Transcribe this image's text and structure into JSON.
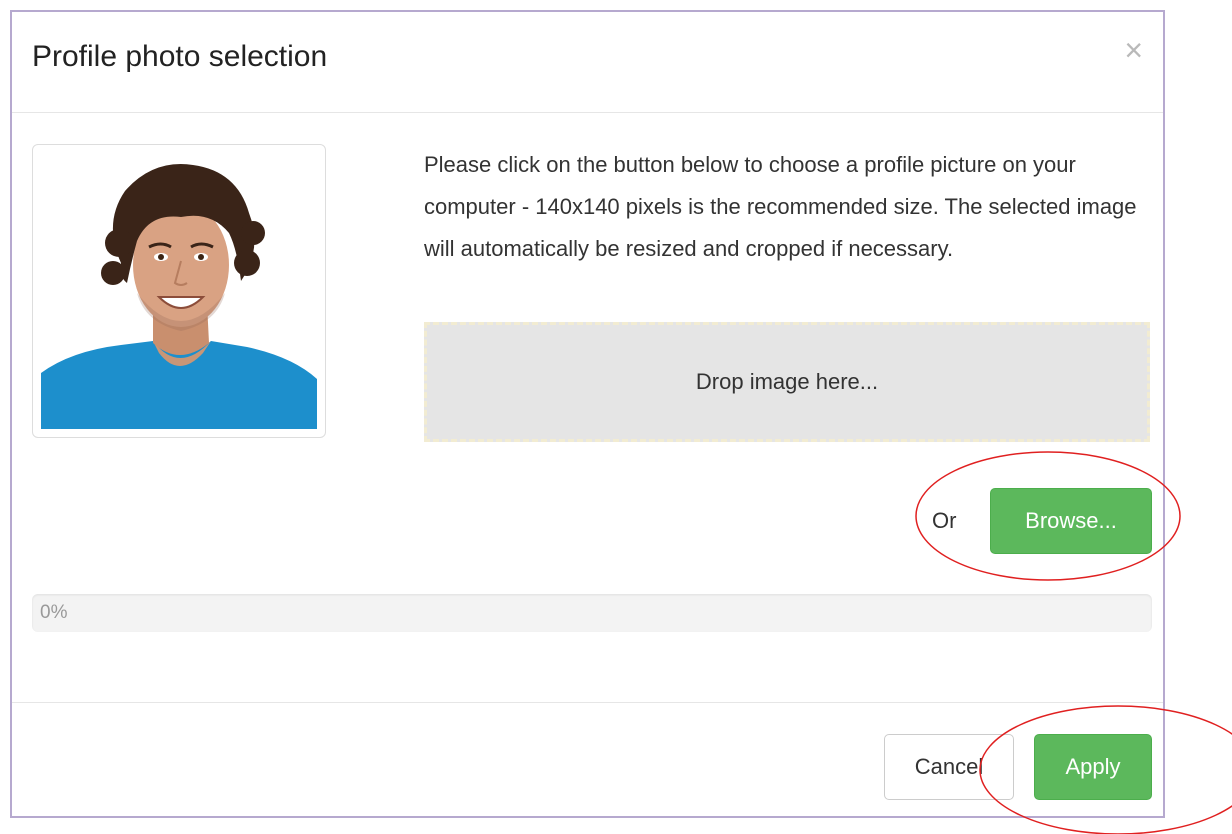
{
  "dialog": {
    "title": "Profile photo selection",
    "close_symbol": "×",
    "close_icon": "close-icon"
  },
  "photo": {
    "icon": "profile-photo"
  },
  "description": "Please click on the button below to choose a profile picture on your computer - 140x140 pixels is the recommended size. The selected image will automatically be resized and cropped if necessary.",
  "dropzone": {
    "label": "Drop image here..."
  },
  "upload": {
    "or_label": "Or",
    "browse_label": "Browse..."
  },
  "progress": {
    "value": 0,
    "label": "0%"
  },
  "footer": {
    "cancel_label": "Cancel",
    "apply_label": "Apply"
  },
  "colors": {
    "accent": "#5cb85c",
    "annotation": "#e02020",
    "modal_border": "#b6a9cf"
  }
}
